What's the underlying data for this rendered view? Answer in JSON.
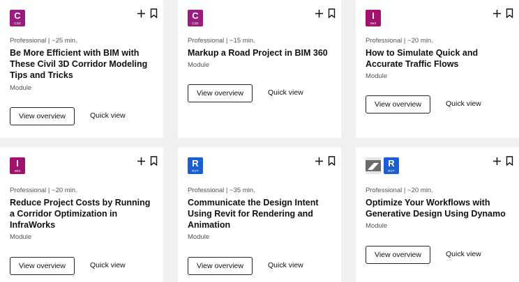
{
  "cards": [
    {
      "icons": [
        {
          "letter": "C",
          "code": "C3D",
          "color": "#9b1b7e",
          "name": "civil-3d-icon"
        }
      ],
      "meta": "Professional | ~25 min.",
      "title": "Be More Efficient with BIM with These Civil 3D Corridor Modeling Tips and Tricks",
      "type": "Module",
      "overview": "View overview",
      "quick": "Quick view"
    },
    {
      "icons": [
        {
          "letter": "C",
          "code": "C3D",
          "color": "#9b1b7e",
          "name": "civil-3d-icon"
        }
      ],
      "meta": "Professional | ~15 min.",
      "title": "Markup a Road Project in BIM 360",
      "type": "Module",
      "overview": "View overview",
      "quick": "Quick view"
    },
    {
      "icons": [
        {
          "letter": "I",
          "code": "IWX",
          "color": "#a1126f",
          "name": "infraworks-icon"
        }
      ],
      "meta": "Professional | ~20 min.",
      "title": "How to Simulate Quick and Accurate Traffic Flows",
      "type": "Module",
      "overview": "View overview",
      "quick": "Quick view"
    },
    {
      "icons": [
        {
          "letter": "I",
          "code": "IWX",
          "color": "#a1126f",
          "name": "infraworks-icon"
        }
      ],
      "meta": "Professional | ~20 min.",
      "title": "Reduce Project Costs by Running a Corridor Optimization in InfraWorks",
      "type": "Module",
      "overview": "View overview",
      "quick": "Quick view"
    },
    {
      "icons": [
        {
          "letter": "R",
          "code": "RVT",
          "color": "#1a5fd1",
          "name": "revit-icon"
        }
      ],
      "meta": "Professional | ~35 min.",
      "title": "Communicate the Design Intent Using Revit for Rendering and Animation",
      "type": "Module",
      "overview": "View overview",
      "quick": "Quick view"
    },
    {
      "icons": [
        {
          "letter": "",
          "code": "",
          "color": "#555555",
          "name": "dynamo-icon"
        },
        {
          "letter": "R",
          "code": "RVT",
          "color": "#1a5fd1",
          "name": "revit-icon"
        }
      ],
      "meta": "Professional | ~20 min.",
      "title": "Optimize Your Workflows with Generative Design Using Dynamo",
      "type": "Module",
      "overview": "View overview",
      "quick": "Quick view"
    }
  ]
}
